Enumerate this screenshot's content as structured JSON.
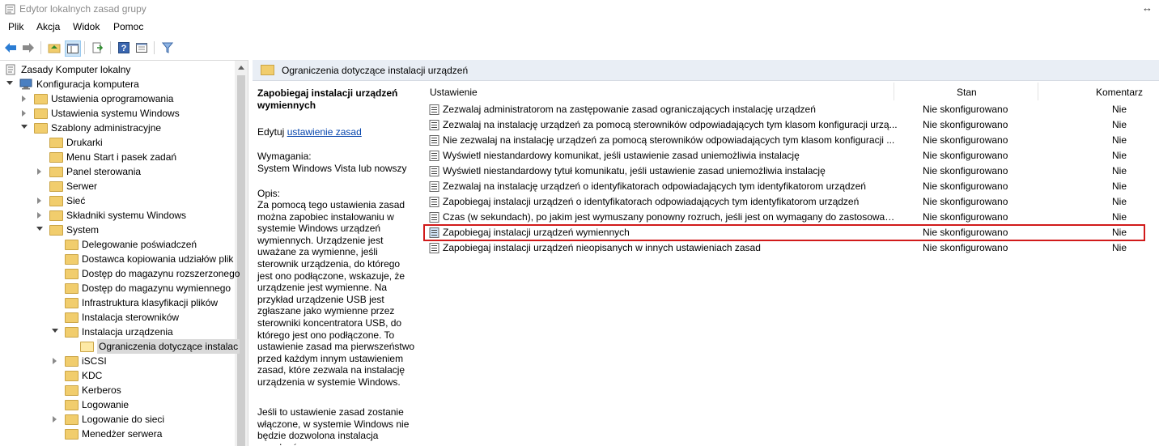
{
  "window": {
    "title": "Edytor lokalnych zasad grupy"
  },
  "menu": [
    "Plik",
    "Akcja",
    "Widok",
    "Pomoc"
  ],
  "tree": [
    {
      "label": "Zasady Komputer lokalny",
      "level": 0,
      "toggle": "none",
      "icon": "policy-doc-icon"
    },
    {
      "label": "Konfiguracja komputera",
      "level": 0,
      "toggle": "expanded",
      "icon": "computer-icon"
    },
    {
      "label": "Ustawienia oprogramowania",
      "level": 1,
      "toggle": "collapsed",
      "icon": "folder-icon"
    },
    {
      "label": "Ustawienia systemu Windows",
      "level": 1,
      "toggle": "collapsed",
      "icon": "folder-icon"
    },
    {
      "label": "Szablony administracyjne",
      "level": 1,
      "toggle": "expanded",
      "icon": "folder-icon"
    },
    {
      "label": "Drukarki",
      "level": 2,
      "toggle": "none",
      "icon": "folder-icon"
    },
    {
      "label": "Menu Start i pasek zadań",
      "level": 2,
      "toggle": "none",
      "icon": "folder-icon"
    },
    {
      "label": "Panel sterowania",
      "level": 2,
      "toggle": "collapsed",
      "icon": "folder-icon"
    },
    {
      "label": "Serwer",
      "level": 2,
      "toggle": "none",
      "icon": "folder-icon"
    },
    {
      "label": "Sieć",
      "level": 2,
      "toggle": "collapsed",
      "icon": "folder-icon"
    },
    {
      "label": "Składniki systemu Windows",
      "level": 2,
      "toggle": "collapsed",
      "icon": "folder-icon"
    },
    {
      "label": "System",
      "level": 2,
      "toggle": "expanded",
      "icon": "folder-icon"
    },
    {
      "label": "Delegowanie poświadczeń",
      "level": 3,
      "toggle": "none",
      "icon": "folder-icon"
    },
    {
      "label": "Dostawca kopiowania udziałów plik",
      "level": 3,
      "toggle": "none",
      "icon": "folder-icon"
    },
    {
      "label": "Dostęp do magazynu rozszerzonego",
      "level": 3,
      "toggle": "none",
      "icon": "folder-icon"
    },
    {
      "label": "Dostęp do magazynu wymiennego",
      "level": 3,
      "toggle": "none",
      "icon": "folder-icon"
    },
    {
      "label": "Infrastruktura klasyfikacji plików",
      "level": 3,
      "toggle": "none",
      "icon": "folder-icon"
    },
    {
      "label": "Instalacja sterowników",
      "level": 3,
      "toggle": "none",
      "icon": "folder-icon"
    },
    {
      "label": "Instalacja urządzenia",
      "level": 3,
      "toggle": "expanded",
      "icon": "folder-icon"
    },
    {
      "label": "Ograniczenia dotyczące instalac",
      "level": 4,
      "toggle": "none",
      "icon": "folder-open-icon",
      "selected": true
    },
    {
      "label": "iSCSI",
      "level": 3,
      "toggle": "collapsed",
      "icon": "folder-icon"
    },
    {
      "label": "KDC",
      "level": 3,
      "toggle": "none",
      "icon": "folder-icon"
    },
    {
      "label": "Kerberos",
      "level": 3,
      "toggle": "none",
      "icon": "folder-icon"
    },
    {
      "label": "Logowanie",
      "level": 3,
      "toggle": "none",
      "icon": "folder-icon"
    },
    {
      "label": "Logowanie do sieci",
      "level": 3,
      "toggle": "collapsed",
      "icon": "folder-icon"
    },
    {
      "label": "Menedżer serwera",
      "level": 3,
      "toggle": "none",
      "icon": "folder-icon"
    }
  ],
  "detail": {
    "header": "Ograniczenia dotyczące instalacji urządzeń",
    "description": {
      "title": "Zapobiegaj instalacji urządzeń wymiennych",
      "edit_prefix": "Edytuj ",
      "edit_link": "ustawienie zasad",
      "requirements_label": "Wymagania:",
      "requirements_value": "System Windows Vista lub nowszy",
      "opis_label": "Opis:",
      "opis_text": "Za pomocą tego ustawienia zasad można zapobiec instalowaniu w systemie Windows urządzeń wymiennych. Urządzenie jest uważane za wymienne, jeśli sterownik urządzenia, do którego jest ono podłączone, wskazuje, że urządzenie jest wymienne. Na przykład urządzenie USB jest zgłaszane jako wymienne przez sterowniki koncentratora USB, do którego jest ono podłączone. To ustawienie zasad ma pierwszeństwo przed każdym innym ustawieniem zasad, które zezwala na instalację urządzenia w systemie Windows.",
      "opis_text2": "Jeśli to ustawienie zasad zostanie włączone, w systemie Windows nie będzie dozwolona instalacja urządzeń"
    },
    "columns": {
      "setting": "Ustawienie",
      "state": "Stan",
      "comment": "Komentarz"
    },
    "rows": [
      {
        "name": "Zezwalaj administratorom na zastępowanie zasad ograniczających instalację urządzeń",
        "state": "Nie skonfigurowano",
        "comment": "Nie"
      },
      {
        "name": "Zezwalaj na instalację urządzeń za pomocą sterowników odpowiadających tym klasom konfiguracji urzą...",
        "state": "Nie skonfigurowano",
        "comment": "Nie"
      },
      {
        "name": "Nie zezwalaj na instalację urządzeń za pomocą sterowników odpowiadających tym klasom konfiguracji ...",
        "state": "Nie skonfigurowano",
        "comment": "Nie"
      },
      {
        "name": "Wyświetl niestandardowy komunikat, jeśli ustawienie zasad uniemożliwia instalację",
        "state": "Nie skonfigurowano",
        "comment": "Nie"
      },
      {
        "name": "Wyświetl niestandardowy tytuł komunikatu, jeśli ustawienie zasad uniemożliwia instalację",
        "state": "Nie skonfigurowano",
        "comment": "Nie"
      },
      {
        "name": "Zezwalaj na instalację urządzeń o identyfikatorach odpowiadających tym identyfikatorom urządzeń",
        "state": "Nie skonfigurowano",
        "comment": "Nie"
      },
      {
        "name": "Zapobiegaj instalacji urządzeń o identyfikatorach odpowiadających tym identyfikatorom urządzeń",
        "state": "Nie skonfigurowano",
        "comment": "Nie"
      },
      {
        "name": "Czas (w sekundach), po jakim jest wymuszany ponowny rozruch, jeśli jest on wymagany do zastosowani...",
        "state": "Nie skonfigurowano",
        "comment": "Nie"
      },
      {
        "name": "Zapobiegaj instalacji urządzeń wymiennych",
        "state": "Nie skonfigurowano",
        "comment": "Nie",
        "highlighted": true
      },
      {
        "name": "Zapobiegaj instalacji urządzeń nieopisanych w innych ustawieniach zasad",
        "state": "Nie skonfigurowano",
        "comment": "Nie"
      }
    ]
  },
  "colors": {
    "highlight_border": "#d11a1a",
    "header_bg": "#e9eef5",
    "link": "#0645ad"
  }
}
